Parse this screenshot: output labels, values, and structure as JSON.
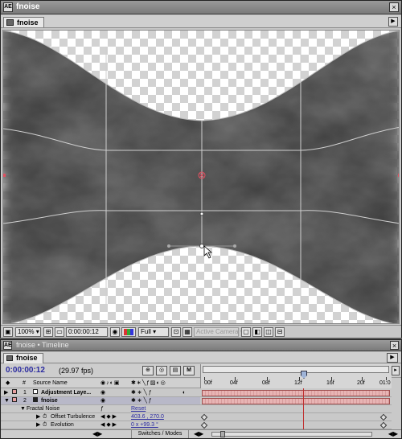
{
  "comp_window": {
    "title": "fnoise",
    "tab_label": "fnoise",
    "app_icon": "AE",
    "close_symbol": "×"
  },
  "comp_toolbar": {
    "magnification": "100%",
    "timecode": "0:00:00:12",
    "resolution": "Full",
    "view": "Active Camera"
  },
  "timeline": {
    "title": "fnoise • Timeline",
    "tab_label": "fnoise",
    "current_time": "0:00:00:12",
    "fps": "(29.97 fps)",
    "columns": {
      "number": "#",
      "source_name": "Source Name"
    },
    "ruler_ticks": [
      "00f",
      "04f",
      "08f",
      "12f",
      "16f",
      "20f",
      "01:0"
    ],
    "layers": [
      {
        "num": "1",
        "name": "Adjustment Laye...",
        "color": "#f0f0f0"
      },
      {
        "num": "2",
        "name": "fnoise",
        "color": "#e8a0a0"
      }
    ],
    "effect": {
      "name": "Fractal Noise",
      "reset": "Reset",
      "properties": [
        {
          "name": "Offset Turbulence",
          "value": "403.6 , 270.0"
        },
        {
          "name": "Evolution",
          "value": "0 x +99.3 °"
        }
      ]
    },
    "footer_label": "Switches / Modes"
  }
}
